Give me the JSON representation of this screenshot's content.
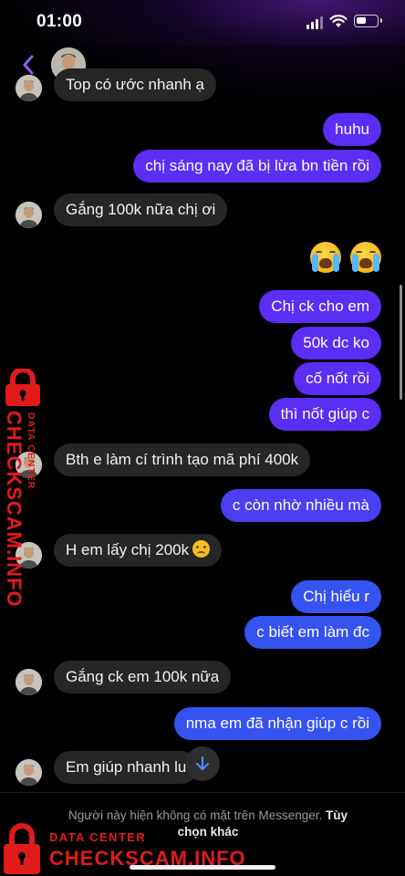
{
  "status_bar": {
    "time": "01:00",
    "battery_level": 0.5
  },
  "header": {
    "back_icon": "chevron-left-icon",
    "contact_avatar": "avatar"
  },
  "messages": {
    "m0": "Top có ước nhanh ạ",
    "m1": "huhu",
    "m2": "chị sáng nay đã bị lừa bn tiền rồi",
    "m3": "Gắng 100k nữa chị ơi",
    "m5": "Chị ck cho em",
    "m6": "50k dc ko",
    "m7": "cố nốt rồi",
    "m8": "thì nốt giúp c",
    "m9": "Bth e làm cí trình tạo mã phí 400k",
    "m10": "c còn nhờ nhiều mà",
    "m11": "H em lấy chị 200k",
    "m12": "Chị hiểu r",
    "m13": "c biết em làm đc",
    "m14": "Gắng ck em 100k nữa",
    "m15": "nma em đã nhận giúp c rồi",
    "m16": "Em giúp nhanh lu"
  },
  "footer": {
    "notice": "Người này hiện không có mặt trên Messenger.",
    "option": "Tùy chọn khác"
  },
  "watermark": {
    "brand": "CHECKSCAM.INFO",
    "sub": "DATA CENTER"
  },
  "colors": {
    "outgoing_purple": "#5b2df5",
    "outgoing_blue": "#3553f0",
    "incoming": "#262626",
    "watermark_red": "#e11b1b",
    "back_chevron": "#8b5cf6"
  }
}
